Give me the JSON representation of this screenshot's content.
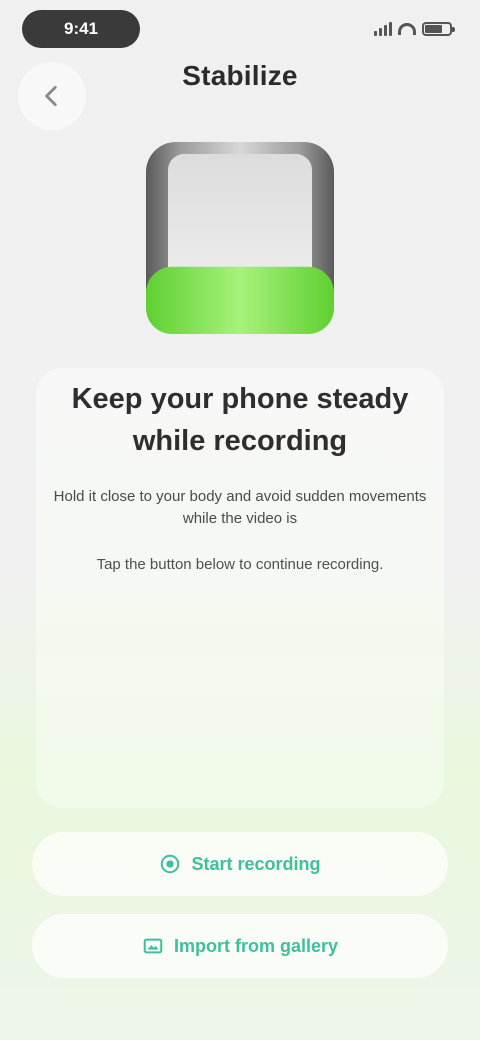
{
  "status_bar": {
    "time": "9:41"
  },
  "header": {
    "title": "Stabilize"
  },
  "content": {
    "headline": "Keep your phone steady while recording",
    "body": "Hold it close to your body and avoid sudden movements while the video is",
    "hint": "Tap the button below to continue recording."
  },
  "actions": {
    "primary_label": "Start recording",
    "secondary_label": "Import from gallery"
  },
  "colors": {
    "accent": "#3fbf9b",
    "level_green": "#7ee34f"
  },
  "icons": {
    "back": "chevron-left-icon",
    "hero": "battery-level-icon",
    "primary": "record-icon",
    "secondary": "gallery-icon"
  },
  "hero_level": 0.35
}
